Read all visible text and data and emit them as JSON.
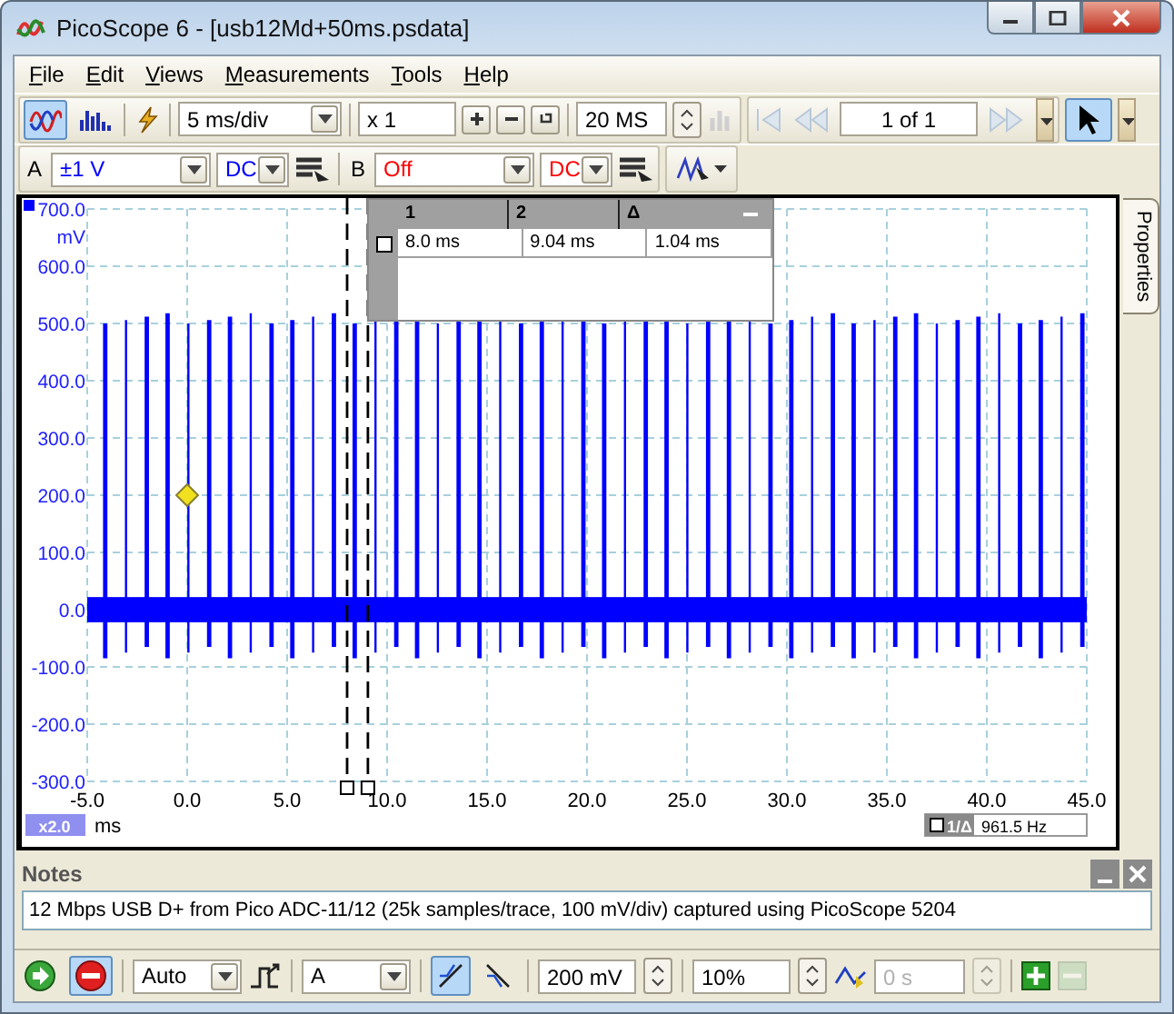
{
  "window": {
    "title": "PicoScope 6 - [usb12Md+50ms.psdata]"
  },
  "menu": [
    "File",
    "Edit",
    "Views",
    "Measurements",
    "Tools",
    "Help"
  ],
  "view_buttons": [
    {
      "kind": "scope",
      "selected": true
    },
    {
      "kind": "spectrum",
      "selected": false
    }
  ],
  "toolbar": {
    "timebase": "5 ms/div",
    "zoom": "x 1",
    "samples": "20 MS",
    "buffer": "1 of 1",
    "pointer_selected": true
  },
  "channels": [
    {
      "name": "A",
      "range": "±1 V",
      "coupling": "DC",
      "color": "#0000ff"
    },
    {
      "name": "B",
      "range": "Off",
      "coupling": "DC",
      "color": "#ff0000"
    }
  ],
  "plot": {
    "y_unit": "mV",
    "y_labels": [
      "700.0",
      "600.0",
      "500.0",
      "400.0",
      "300.0",
      "200.0",
      "100.0",
      "0.0",
      "-100.0",
      "-200.0",
      "-300.0"
    ],
    "x_unit": "ms",
    "x_labels": [
      "-5.0",
      "0.0",
      "5.0",
      "10.0",
      "15.0",
      "20.0",
      "25.0",
      "30.0",
      "35.0",
      "40.0",
      "45.0"
    ],
    "zoom_badge": "x2.0",
    "cursor_table": {
      "columns": [
        "1",
        "2",
        "Δ"
      ],
      "rows": [
        {
          "checked": false,
          "cells": [
            "8.0 ms",
            "9.04 ms",
            "1.04 ms"
          ]
        }
      ]
    },
    "frequency": {
      "label": "1/Δ",
      "value": "961.5 Hz"
    }
  },
  "side_tab": "Properties",
  "notes": {
    "title": "Notes",
    "text": "12 Mbps USB D+ from Pico ADC-11/12 (25k samples/trace, 100 mV/div) captured using PicoScope 5204"
  },
  "run_buttons": [
    {
      "kind": "start",
      "selected": false
    },
    {
      "kind": "stop",
      "selected": true
    }
  ],
  "trigger": {
    "mode": "Auto",
    "source": "A",
    "edges": [
      {
        "kind": "rising",
        "selected": true
      },
      {
        "kind": "falling",
        "selected": false
      }
    ],
    "threshold": "200 mV",
    "pretrigger": "10%",
    "delay": {
      "value": "0 s",
      "disabled": true
    }
  }
}
